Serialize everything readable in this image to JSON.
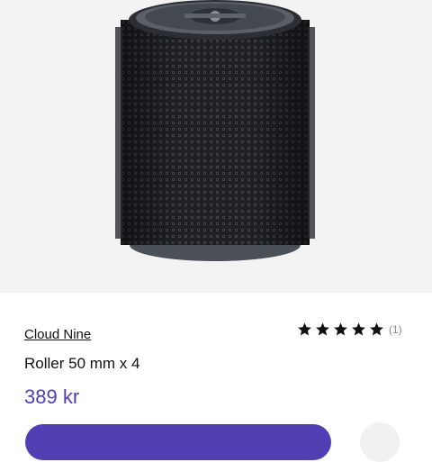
{
  "product": {
    "image_icon": "hair-roller-product-image",
    "brand": "Cloud Nine",
    "name": "Roller 50 mm x 4",
    "price": "389 kr",
    "rating": {
      "stars": 5,
      "max": 5,
      "count_label": "(1)"
    }
  },
  "colors": {
    "accent": "#4f3fb3",
    "hero_bg": "#f3f3f3",
    "text": "#111111",
    "muted": "#888888"
  }
}
